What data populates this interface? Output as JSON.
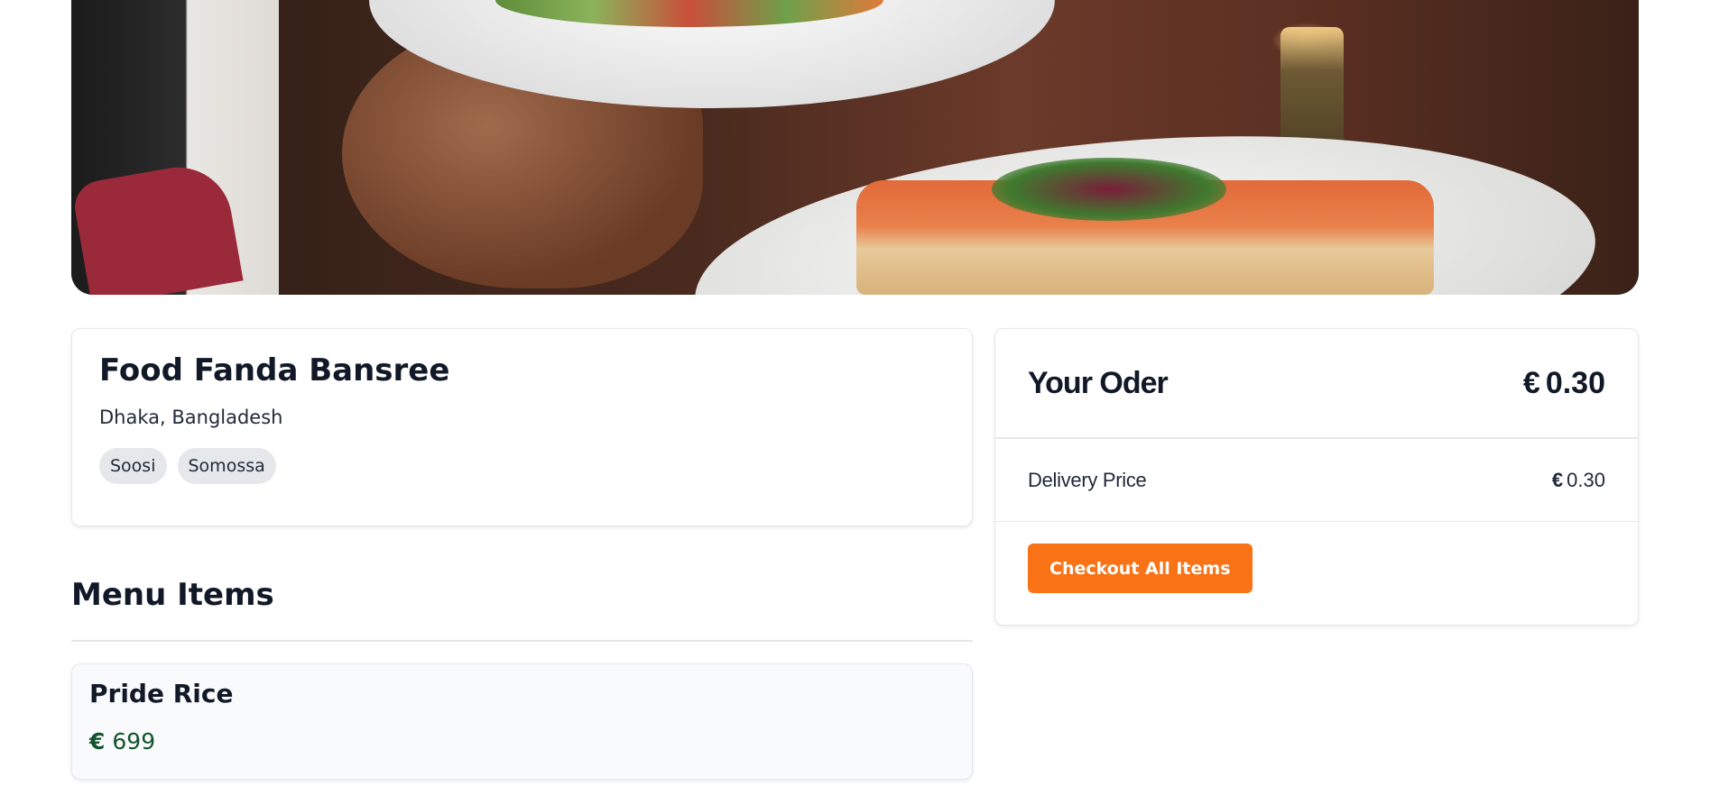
{
  "restaurant": {
    "name": "Food Fanda Bansree",
    "location": "Dhaka, Bangladesh",
    "tags": [
      "Soosi",
      "Somossa"
    ]
  },
  "menu": {
    "title": "Menu Items",
    "items": [
      {
        "name": "Pride Rice",
        "currency": "€",
        "price": "699"
      }
    ]
  },
  "order": {
    "title": "Your Oder",
    "currency": "€",
    "total": "0.30",
    "delivery_label": "Delivery Price",
    "delivery_price": "0.30",
    "checkout_label": "Checkout All Items"
  },
  "colors": {
    "accent": "#f97316",
    "price_green": "#14532d",
    "border": "#e5e7eb"
  }
}
